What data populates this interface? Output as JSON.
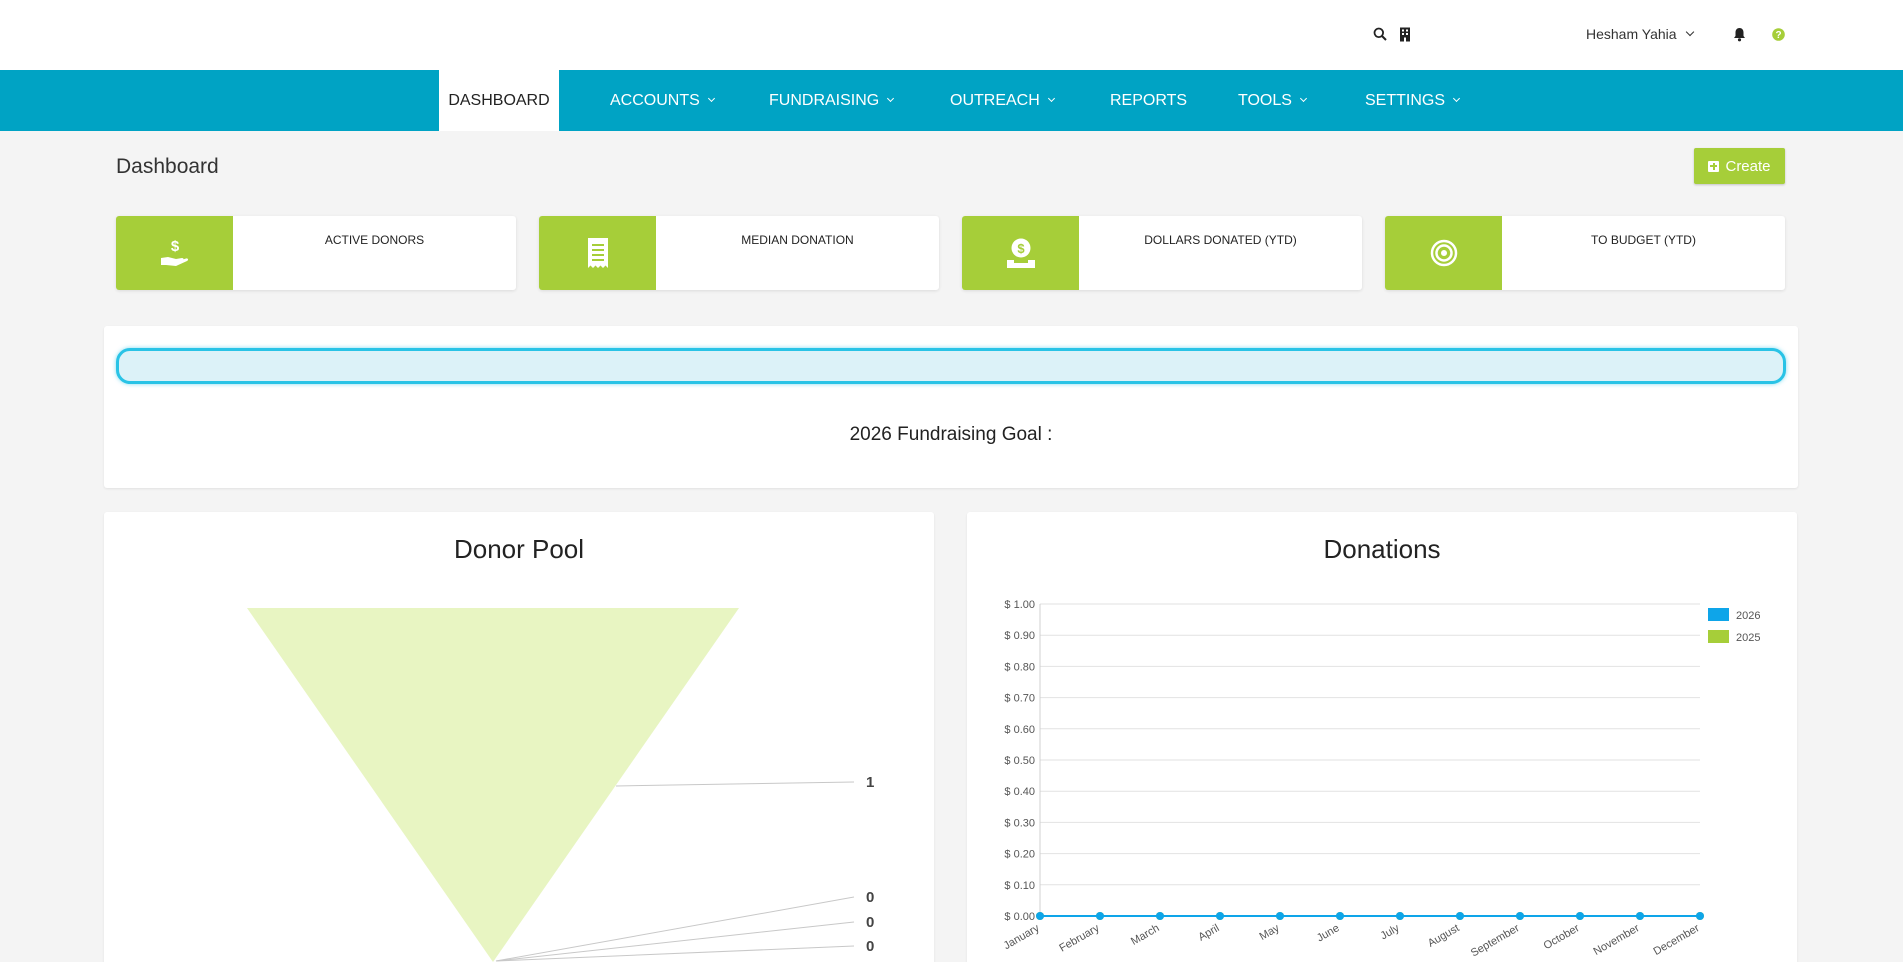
{
  "topbar": {
    "user_name": "Hesham Yahia",
    "icons": [
      "search-icon",
      "building-icon",
      "bell-icon",
      "help-icon"
    ],
    "help_color": "#a6ce39"
  },
  "nav": {
    "items": [
      {
        "label": "DASHBOARD",
        "active": true,
        "dropdown": false
      },
      {
        "label": "ACCOUNTS",
        "active": false,
        "dropdown": true
      },
      {
        "label": "FUNDRAISING",
        "active": false,
        "dropdown": true
      },
      {
        "label": "OUTREACH",
        "active": false,
        "dropdown": true
      },
      {
        "label": "REPORTS",
        "active": false,
        "dropdown": false
      },
      {
        "label": "TOOLS",
        "active": false,
        "dropdown": true
      },
      {
        "label": "SETTINGS",
        "active": false,
        "dropdown": true
      }
    ],
    "bg_color": "#00a3c4"
  },
  "page": {
    "title": "Dashboard",
    "create_label": "Create"
  },
  "kpis": [
    {
      "label": "ACTIVE DONORS",
      "icon": "hand-dollar-icon"
    },
    {
      "label": "MEDIAN DONATION",
      "icon": "receipt-icon"
    },
    {
      "label": "DOLLARS DONATED (YTD)",
      "icon": "coin-hand-icon"
    },
    {
      "label": "TO BUDGET (YTD)",
      "icon": "target-icon"
    }
  ],
  "accent_color": "#a6ce39",
  "goal": {
    "text": "2026 Fundraising Goal :",
    "progress": 0
  },
  "chart_data": [
    {
      "type": "funnel",
      "title": "Donor Pool",
      "values": [
        1,
        0,
        0,
        0
      ],
      "color": "#e8f5c2"
    },
    {
      "type": "line",
      "title": "Donations",
      "categories": [
        "January",
        "February",
        "March",
        "April",
        "May",
        "June",
        "July",
        "August",
        "September",
        "October",
        "November",
        "December"
      ],
      "series": [
        {
          "name": "2026",
          "values": [
            0,
            0,
            0,
            0,
            0,
            0,
            0,
            0,
            0,
            0,
            0,
            0
          ],
          "color": "#0ea5e9"
        },
        {
          "name": "2025",
          "values": [
            0,
            0,
            0,
            0,
            0,
            0,
            0,
            0,
            0,
            0,
            0,
            0
          ],
          "color": "#a6ce39"
        }
      ],
      "yticks": [
        "$ 0.00",
        "$ 0.10",
        "$ 0.20",
        "$ 0.30",
        "$ 0.40",
        "$ 0.50",
        "$ 0.60",
        "$ 0.70",
        "$ 0.80",
        "$ 0.90",
        "$ 1.00"
      ],
      "ylim": [
        0,
        1
      ],
      "grid": true,
      "legend": "top-right"
    }
  ]
}
